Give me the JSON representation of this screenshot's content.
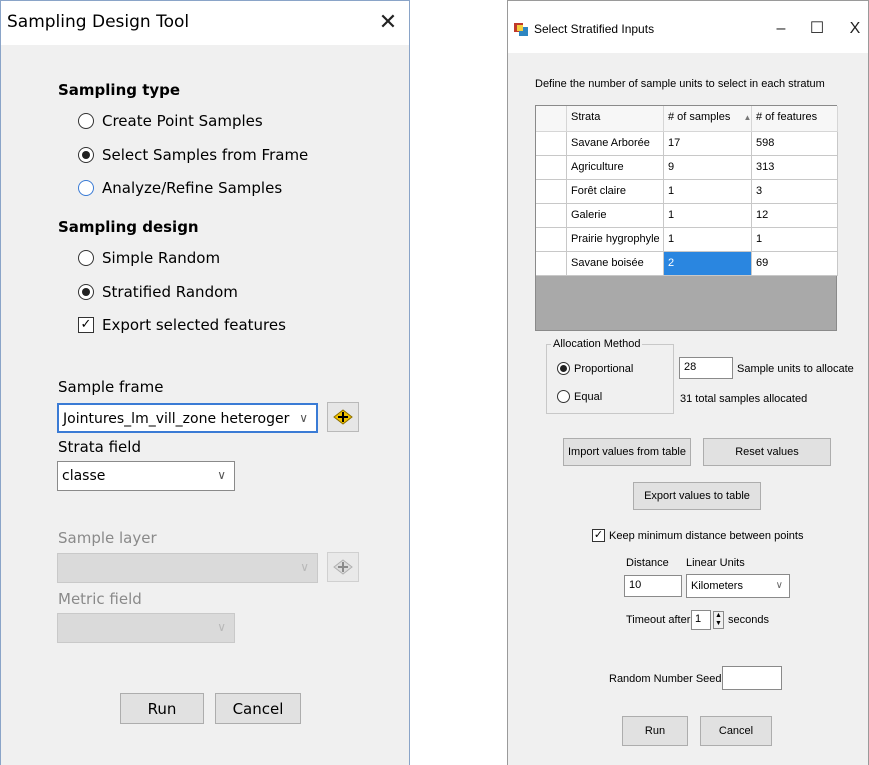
{
  "left": {
    "title": "Sampling Design Tool",
    "close_glyph": "✕",
    "sampling_type": {
      "heading": "Sampling type",
      "options": [
        "Create Point Samples",
        "Select Samples from Frame",
        "Analyze/Refine Samples"
      ],
      "selected": "Select Samples from Frame"
    },
    "sampling_design": {
      "heading": "Sampling design",
      "options": [
        "Simple Random",
        "Stratified Random"
      ],
      "selected": "Stratified Random",
      "export_label": "Export selected features",
      "export_checked": true
    },
    "sample_frame": {
      "label": "Sample frame",
      "value": "Jointures_lm_vill_zone heteroger"
    },
    "strata_field": {
      "label": "Strata field",
      "value": "classe"
    },
    "sample_layer": {
      "label": "Sample layer",
      "value": ""
    },
    "metric_field": {
      "label": "Metric field",
      "value": ""
    },
    "run_label": "Run",
    "cancel_label": "Cancel"
  },
  "right": {
    "title": "Select Stratified Inputs",
    "minimize_glyph": "–",
    "maximize_glyph": "☐",
    "close_glyph": "X",
    "instruction": "Define the number of sample units to select in each stratum",
    "grid": {
      "columns": [
        "Strata",
        "# of samples",
        "# of features"
      ],
      "sort_glyph": "▲",
      "rows": [
        {
          "strata": "Savane Arborée",
          "samples": "17",
          "features": "598"
        },
        {
          "strata": "Agriculture",
          "samples": "9",
          "features": "313"
        },
        {
          "strata": "Forêt claire",
          "samples": "1",
          "features": "3"
        },
        {
          "strata": "Galerie",
          "samples": "1",
          "features": "12"
        },
        {
          "strata": "Prairie hygrophyle",
          "samples": "1",
          "features": "1"
        },
        {
          "strata": "Savane boisée",
          "samples": "2",
          "features": "69"
        }
      ]
    },
    "allocation": {
      "legend": "Allocation Method",
      "proportional": "Proportional",
      "equal": "Equal",
      "selected": "Proportional",
      "units_value": "28",
      "units_label": "Sample units to allocate",
      "total_text": "31 total samples allocated"
    },
    "import_label": "Import values from table",
    "reset_label": "Reset values",
    "export_label": "Export values to table",
    "min_distance": {
      "label": "Keep minimum distance between points",
      "checked": true
    },
    "distance": {
      "label": "Distance",
      "value": "10"
    },
    "linear_units": {
      "label": "Linear Units",
      "value": "Kilometers"
    },
    "timeout": {
      "prefix": "Timeout after",
      "value": "1",
      "suffix": "seconds"
    },
    "seed": {
      "label": "Random Number Seed",
      "value": ""
    },
    "run_label": "Run",
    "cancel_label": "Cancel"
  },
  "colors": {
    "selection": "#2a86e0",
    "accent_blue": "#3a7bd5",
    "window_bg": "#f0f0f0"
  }
}
